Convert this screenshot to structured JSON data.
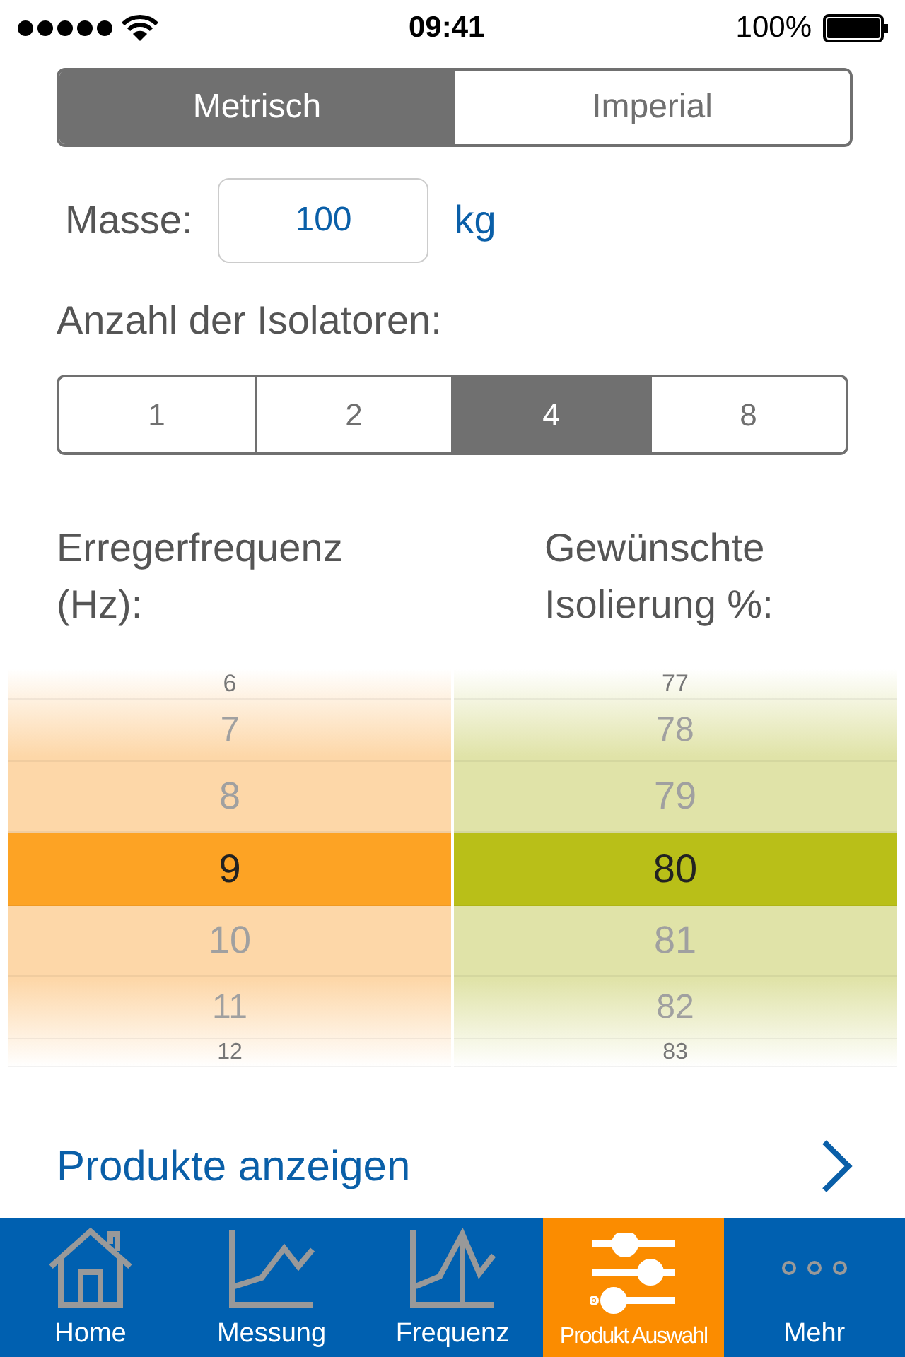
{
  "status_bar": {
    "time": "09:41",
    "battery": "100%"
  },
  "unit_toggle": [
    {
      "label": "Metrisch",
      "selected": true
    },
    {
      "label": "Imperial",
      "selected": false
    }
  ],
  "mass": {
    "label": "Masse:",
    "value": "100",
    "unit": "kg"
  },
  "isolator_count": {
    "label": "Anzahl der Isolatoren:",
    "options": [
      {
        "label": "1",
        "selected": false
      },
      {
        "label": "2",
        "selected": false
      },
      {
        "label": "4",
        "selected": true
      },
      {
        "label": "8",
        "selected": false
      }
    ]
  },
  "pickers": [
    {
      "header": "Erregerfrequenz (Hz):",
      "color": "#fda324",
      "items": [
        {
          "label": "6",
          "selected": false
        },
        {
          "label": "7",
          "selected": false
        },
        {
          "label": "8",
          "selected": false
        },
        {
          "label": "9",
          "selected": true
        },
        {
          "label": "10",
          "selected": false
        },
        {
          "label": "11",
          "selected": false
        },
        {
          "label": "12",
          "selected": false
        }
      ]
    },
    {
      "header": "Gewünschte Isolierung %:",
      "color": "#b9bf18",
      "items": [
        {
          "label": "77",
          "selected": false
        },
        {
          "label": "78",
          "selected": false
        },
        {
          "label": "79",
          "selected": false
        },
        {
          "label": "80",
          "selected": true
        },
        {
          "label": "81",
          "selected": false
        },
        {
          "label": "82",
          "selected": false
        },
        {
          "label": "83",
          "selected": false
        }
      ]
    }
  ],
  "show_products": {
    "label": "Produkte anzeigen"
  },
  "tab_bar": [
    {
      "label": "Home",
      "kind": "home",
      "selected": false
    },
    {
      "label": "Messung",
      "kind": "measure",
      "selected": false
    },
    {
      "label": "Frequenz",
      "kind": "frequency",
      "selected": false
    },
    {
      "label": "Produkt Auswahl",
      "kind": "sliders",
      "selected": true
    },
    {
      "label": "Mehr",
      "kind": "more",
      "selected": false
    }
  ]
}
